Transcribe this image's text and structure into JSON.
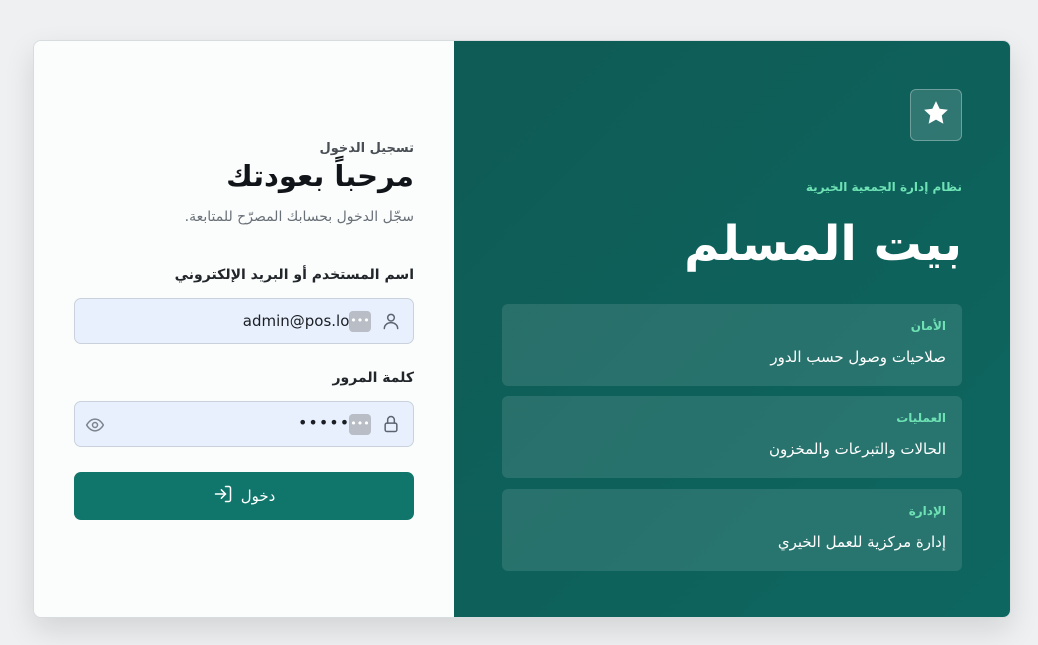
{
  "login": {
    "eyebrow": "تسجيل الدخول",
    "title": "مرحباً بعودتك",
    "subtitle": "سجّل الدخول بحسابك المصرّح للمتابعة.",
    "username": {
      "label": "اسم المستخدم أو البريد الإلكتروني",
      "value": "admin@pos.local",
      "icon": "user-icon"
    },
    "password": {
      "label": "كلمة المرور",
      "value": "•••••••",
      "icon": "lock-icon",
      "toggle_icon": "eye-icon"
    },
    "autofill_chip": "•••",
    "submit_label": "دخول",
    "submit_icon": "login-arrow-icon"
  },
  "brand": {
    "logo_icon": "star-icon",
    "kicker": "نظام إدارة الجمعية الخيرية",
    "title": "بيت المسلم",
    "features": [
      {
        "label": "الأمان",
        "text": "صلاحيات وصول حسب الدور"
      },
      {
        "label": "العمليات",
        "text": "الحالات والتبرعات والمخزون"
      },
      {
        "label": "الإدارة",
        "text": "إدارة مركزية للعمل الخيري"
      }
    ]
  },
  "colors": {
    "primary": "#10756a",
    "brand_bg": "#0f5b55",
    "accent_text": "#6ee2b4",
    "input_bg": "#e8f0fd"
  }
}
